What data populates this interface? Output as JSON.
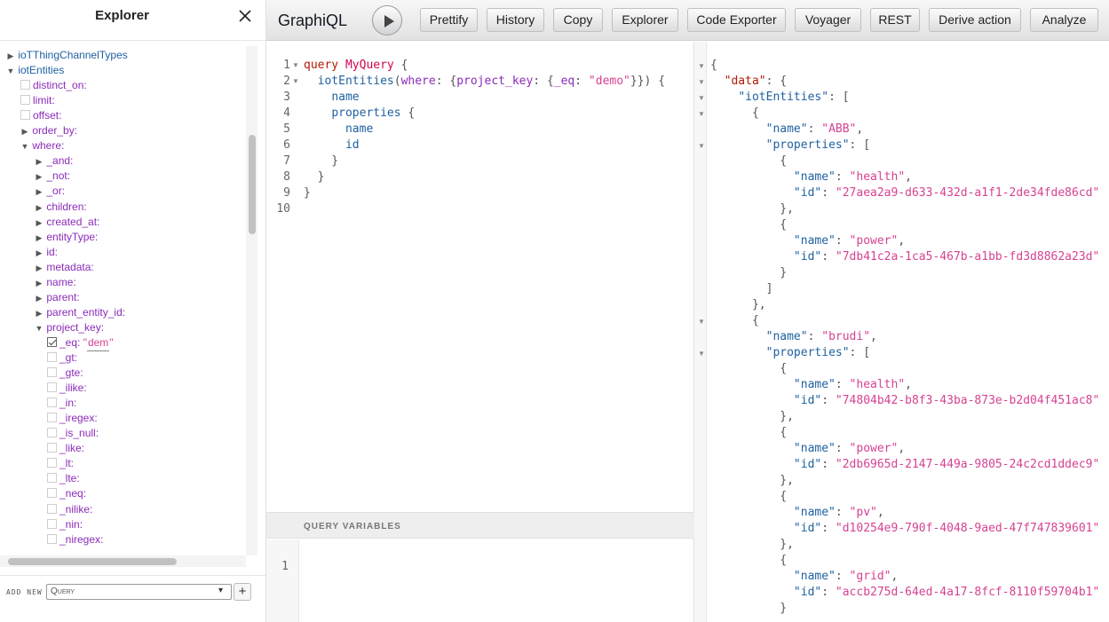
{
  "explorer": {
    "title": "Explorer",
    "tree": [
      {
        "label": "ioTThingChannelTypes",
        "level": 0,
        "kind": "collapsed"
      },
      {
        "label": "iotEntities",
        "level": 0,
        "kind": "expanded"
      },
      {
        "label": "distinct_on:",
        "level": 1,
        "kind": "checkbox"
      },
      {
        "label": "limit:",
        "level": 1,
        "kind": "checkbox"
      },
      {
        "label": "offset:",
        "level": 1,
        "kind": "checkbox"
      },
      {
        "label": "order_by:",
        "level": 1,
        "kind": "collapsed"
      },
      {
        "label": "where:",
        "level": 1,
        "kind": "expanded"
      },
      {
        "label": "_and:",
        "level": 2,
        "kind": "collapsed"
      },
      {
        "label": "_not:",
        "level": 2,
        "kind": "collapsed"
      },
      {
        "label": "_or:",
        "level": 2,
        "kind": "collapsed"
      },
      {
        "label": "children:",
        "level": 2,
        "kind": "collapsed"
      },
      {
        "label": "created_at:",
        "level": 2,
        "kind": "collapsed"
      },
      {
        "label": "entityType:",
        "level": 2,
        "kind": "collapsed"
      },
      {
        "label": "id:",
        "level": 2,
        "kind": "collapsed"
      },
      {
        "label": "metadata:",
        "level": 2,
        "kind": "collapsed"
      },
      {
        "label": "name:",
        "level": 2,
        "kind": "collapsed"
      },
      {
        "label": "parent:",
        "level": 2,
        "kind": "collapsed"
      },
      {
        "label": "parent_entity_id:",
        "level": 2,
        "kind": "collapsed"
      },
      {
        "label": "project_key:",
        "level": 2,
        "kind": "expanded"
      },
      {
        "label": "_eq:",
        "level": 3,
        "kind": "checked",
        "value": "dem"
      },
      {
        "label": "_gt:",
        "level": 3,
        "kind": "checkbox"
      },
      {
        "label": "_gte:",
        "level": 3,
        "kind": "checkbox"
      },
      {
        "label": "_ilike:",
        "level": 3,
        "kind": "checkbox"
      },
      {
        "label": "_in:",
        "level": 3,
        "kind": "checkbox"
      },
      {
        "label": "_iregex:",
        "level": 3,
        "kind": "checkbox"
      },
      {
        "label": "_is_null:",
        "level": 3,
        "kind": "checkbox"
      },
      {
        "label": "_like:",
        "level": 3,
        "kind": "checkbox"
      },
      {
        "label": "_lt:",
        "level": 3,
        "kind": "checkbox"
      },
      {
        "label": "_lte:",
        "level": 3,
        "kind": "checkbox"
      },
      {
        "label": "_neq:",
        "level": 3,
        "kind": "checkbox"
      },
      {
        "label": "_nilike:",
        "level": 3,
        "kind": "checkbox"
      },
      {
        "label": "_nin:",
        "level": 3,
        "kind": "checkbox"
      },
      {
        "label": "_niregex:",
        "level": 3,
        "kind": "checkbox"
      }
    ],
    "footer": {
      "add_new_label": "ADD NEW",
      "operation_select": "Query",
      "add_button": "+"
    }
  },
  "toolbar": {
    "app_title": "GraphiQL",
    "buttons": [
      "Prettify",
      "History",
      "Copy",
      "Explorer",
      "Code Exporter",
      "Voyager",
      "REST",
      "Derive action",
      "Analyze"
    ]
  },
  "query_editor": {
    "lines": [
      [
        [
          "kw",
          "query"
        ],
        [
          "punc",
          " "
        ],
        [
          "def",
          "MyQuery"
        ],
        [
          "punc",
          " {"
        ]
      ],
      [
        [
          "punc",
          "  "
        ],
        [
          "prop",
          "iotEntities"
        ],
        [
          "punc",
          "("
        ],
        [
          "attr",
          "where"
        ],
        [
          "punc",
          ": {"
        ],
        [
          "attr",
          "project_key"
        ],
        [
          "punc",
          ": {"
        ],
        [
          "attr",
          "_eq"
        ],
        [
          "punc",
          ": "
        ],
        [
          "str",
          "\"demo\""
        ],
        [
          "punc",
          "}}) {"
        ]
      ],
      [
        [
          "punc",
          "    "
        ],
        [
          "prop",
          "name"
        ]
      ],
      [
        [
          "punc",
          "    "
        ],
        [
          "prop",
          "properties"
        ],
        [
          "punc",
          " {"
        ]
      ],
      [
        [
          "punc",
          "      "
        ],
        [
          "prop",
          "name"
        ]
      ],
      [
        [
          "punc",
          "      "
        ],
        [
          "prop",
          "id"
        ]
      ],
      [
        [
          "punc",
          "    }"
        ]
      ],
      [
        [
          "punc",
          "  }"
        ]
      ],
      [
        [
          "punc",
          "}"
        ]
      ],
      []
    ],
    "fold_lines": [
      1,
      2
    ]
  },
  "variables": {
    "title": "QUERY VARIABLES",
    "line_number": "1"
  },
  "result": {
    "lines": [
      [
        [
          "punc",
          "{"
        ]
      ],
      [
        [
          "punc",
          "  "
        ],
        [
          "jd",
          "\"data\""
        ],
        [
          "punc",
          ": {"
        ]
      ],
      [
        [
          "punc",
          "    "
        ],
        [
          "jk",
          "\"iotEntities\""
        ],
        [
          "punc",
          ": ["
        ]
      ],
      [
        [
          "punc",
          "      {"
        ]
      ],
      [
        [
          "punc",
          "        "
        ],
        [
          "jk",
          "\"name\""
        ],
        [
          "punc",
          ": "
        ],
        [
          "js",
          "\"ABB\""
        ],
        [
          "punc",
          ","
        ]
      ],
      [
        [
          "punc",
          "        "
        ],
        [
          "jk",
          "\"properties\""
        ],
        [
          "punc",
          ": ["
        ]
      ],
      [
        [
          "punc",
          "          {"
        ]
      ],
      [
        [
          "punc",
          "            "
        ],
        [
          "jk",
          "\"name\""
        ],
        [
          "punc",
          ": "
        ],
        [
          "js",
          "\"health\""
        ],
        [
          "punc",
          ","
        ]
      ],
      [
        [
          "punc",
          "            "
        ],
        [
          "jk",
          "\"id\""
        ],
        [
          "punc",
          ": "
        ],
        [
          "js",
          "\"27aea2a9-d633-432d-a1f1-2de34fde86cd\""
        ]
      ],
      [
        [
          "punc",
          "          },"
        ]
      ],
      [
        [
          "punc",
          "          {"
        ]
      ],
      [
        [
          "punc",
          "            "
        ],
        [
          "jk",
          "\"name\""
        ],
        [
          "punc",
          ": "
        ],
        [
          "js",
          "\"power\""
        ],
        [
          "punc",
          ","
        ]
      ],
      [
        [
          "punc",
          "            "
        ],
        [
          "jk",
          "\"id\""
        ],
        [
          "punc",
          ": "
        ],
        [
          "js",
          "\"7db41c2a-1ca5-467b-a1bb-fd3d8862a23d\""
        ]
      ],
      [
        [
          "punc",
          "          }"
        ]
      ],
      [
        [
          "punc",
          "        ]"
        ]
      ],
      [
        [
          "punc",
          "      },"
        ]
      ],
      [
        [
          "punc",
          "      {"
        ]
      ],
      [
        [
          "punc",
          "        "
        ],
        [
          "jk",
          "\"name\""
        ],
        [
          "punc",
          ": "
        ],
        [
          "js",
          "\"brudi\""
        ],
        [
          "punc",
          ","
        ]
      ],
      [
        [
          "punc",
          "        "
        ],
        [
          "jk",
          "\"properties\""
        ],
        [
          "punc",
          ": ["
        ]
      ],
      [
        [
          "punc",
          "          {"
        ]
      ],
      [
        [
          "punc",
          "            "
        ],
        [
          "jk",
          "\"name\""
        ],
        [
          "punc",
          ": "
        ],
        [
          "js",
          "\"health\""
        ],
        [
          "punc",
          ","
        ]
      ],
      [
        [
          "punc",
          "            "
        ],
        [
          "jk",
          "\"id\""
        ],
        [
          "punc",
          ": "
        ],
        [
          "js",
          "\"74804b42-b8f3-43ba-873e-b2d04f451ac8\""
        ]
      ],
      [
        [
          "punc",
          "          },"
        ]
      ],
      [
        [
          "punc",
          "          {"
        ]
      ],
      [
        [
          "punc",
          "            "
        ],
        [
          "jk",
          "\"name\""
        ],
        [
          "punc",
          ": "
        ],
        [
          "js",
          "\"power\""
        ],
        [
          "punc",
          ","
        ]
      ],
      [
        [
          "punc",
          "            "
        ],
        [
          "jk",
          "\"id\""
        ],
        [
          "punc",
          ": "
        ],
        [
          "js",
          "\"2db6965d-2147-449a-9805-24c2cd1ddec9\""
        ]
      ],
      [
        [
          "punc",
          "          },"
        ]
      ],
      [
        [
          "punc",
          "          {"
        ]
      ],
      [
        [
          "punc",
          "            "
        ],
        [
          "jk",
          "\"name\""
        ],
        [
          "punc",
          ": "
        ],
        [
          "js",
          "\"pv\""
        ],
        [
          "punc",
          ","
        ]
      ],
      [
        [
          "punc",
          "            "
        ],
        [
          "jk",
          "\"id\""
        ],
        [
          "punc",
          ": "
        ],
        [
          "js",
          "\"d10254e9-790f-4048-9aed-47f747839601\""
        ]
      ],
      [
        [
          "punc",
          "          },"
        ]
      ],
      [
        [
          "punc",
          "          {"
        ]
      ],
      [
        [
          "punc",
          "            "
        ],
        [
          "jk",
          "\"name\""
        ],
        [
          "punc",
          ": "
        ],
        [
          "js",
          "\"grid\""
        ],
        [
          "punc",
          ","
        ]
      ],
      [
        [
          "punc",
          "            "
        ],
        [
          "jk",
          "\"id\""
        ],
        [
          "punc",
          ": "
        ],
        [
          "js",
          "\"accb275d-64ed-4a17-8fcf-8110f59704b1\""
        ]
      ],
      [
        [
          "punc",
          "          }"
        ]
      ]
    ],
    "fold_lines": [
      1,
      2,
      3,
      4,
      6,
      17,
      19
    ]
  }
}
